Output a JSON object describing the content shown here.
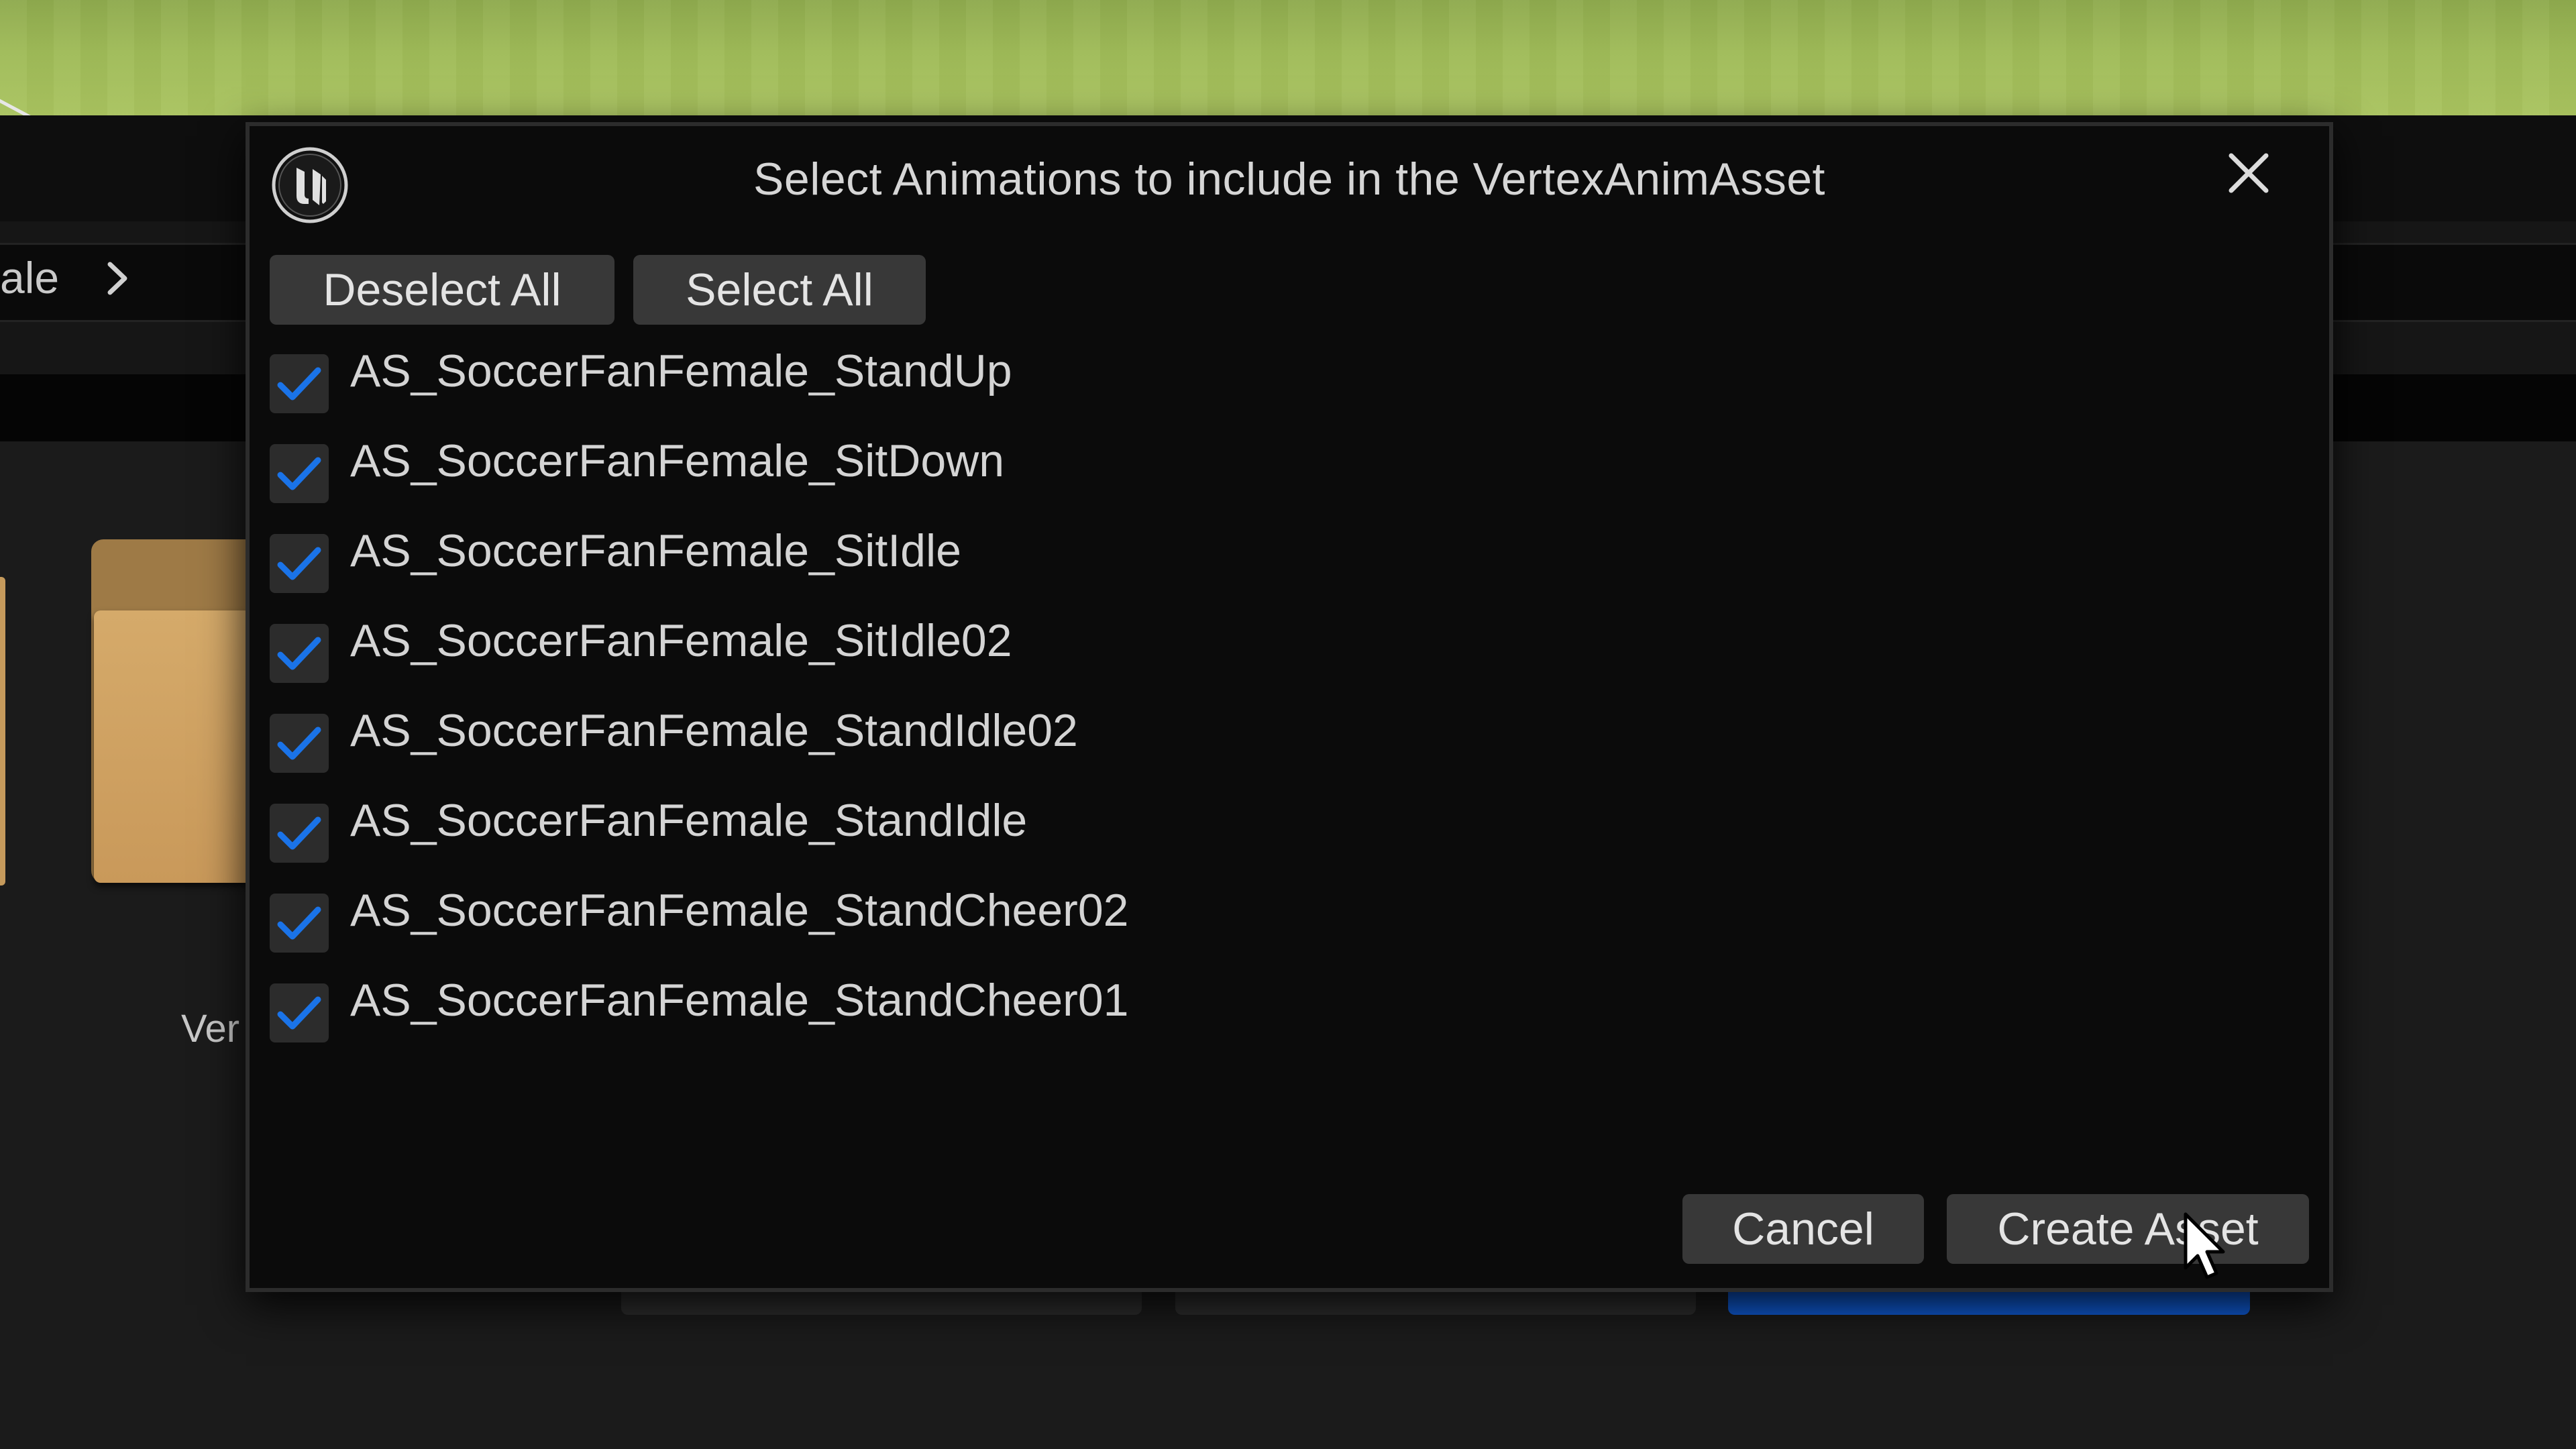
{
  "background": {
    "breadcrumb_text": "ale",
    "folder_label": "Ver"
  },
  "dialog": {
    "title": "Select Animations to include in the VertexAnimAsset",
    "deselect_all_label": "Deselect All",
    "select_all_label": "Select All",
    "animations": [
      {
        "label": "AS_SoccerFanFemale_StandUp",
        "checked": true
      },
      {
        "label": "AS_SoccerFanFemale_SitDown",
        "checked": true
      },
      {
        "label": "AS_SoccerFanFemale_SitIdle",
        "checked": true
      },
      {
        "label": "AS_SoccerFanFemale_SitIdle02",
        "checked": true
      },
      {
        "label": "AS_SoccerFanFemale_StandIdle02",
        "checked": true
      },
      {
        "label": "AS_SoccerFanFemale_StandIdle",
        "checked": true
      },
      {
        "label": "AS_SoccerFanFemale_StandCheer02",
        "checked": true
      },
      {
        "label": "AS_SoccerFanFemale_StandCheer01",
        "checked": true
      }
    ],
    "cancel_label": "Cancel",
    "create_label": "Create Asset"
  },
  "colors": {
    "checkmark": "#1a73e8",
    "dialog_bg": "#0b0b0b",
    "button_bg": "#383838"
  },
  "icons": {
    "logo": "unreal-engine-logo-icon",
    "close": "close-icon",
    "checkbox": "checkmark-icon",
    "cursor": "mouse-cursor-icon",
    "chevron": "chevron-right-icon"
  }
}
